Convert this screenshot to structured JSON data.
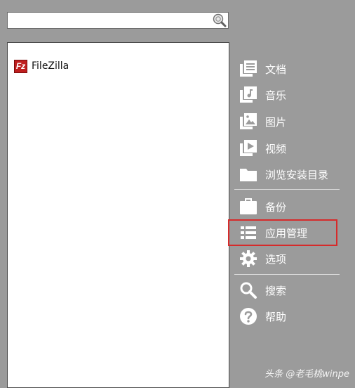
{
  "search": {
    "value": "",
    "placeholder": ""
  },
  "apps": [
    {
      "name": "FileZilla",
      "logo_text": "Fz"
    }
  ],
  "menu": {
    "documents": "文档",
    "music": "音乐",
    "pictures": "图片",
    "videos": "视频",
    "browse_install_dir": "浏览安装目录",
    "backup": "备份",
    "app_manage": "应用管理",
    "options": "选项",
    "search": "搜索",
    "help": "帮助"
  },
  "watermark": "头条 @老毛桃winpe",
  "colors": {
    "background": "#9b9b9b",
    "highlight_border": "#d62b2b",
    "filezilla_red": "#bf1e1e"
  }
}
